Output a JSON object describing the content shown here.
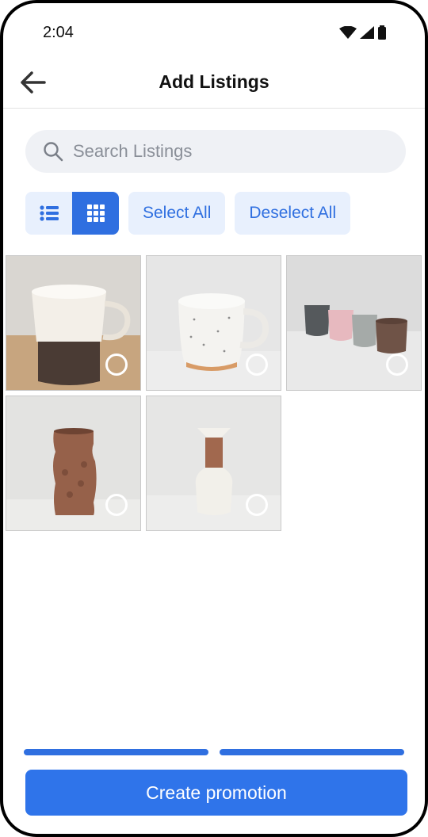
{
  "status_bar": {
    "time": "2:04",
    "icons": [
      "wifi-icon",
      "signal-icon",
      "battery-icon"
    ]
  },
  "header": {
    "title": "Add Listings",
    "back_icon": "arrow-left-icon"
  },
  "search": {
    "placeholder": "Search Listings",
    "value": "",
    "icon": "search-icon"
  },
  "view_toggle": {
    "options": [
      "list-view",
      "grid-view"
    ],
    "selected": "grid-view"
  },
  "actions": {
    "select_all": "Select All",
    "deselect_all": "Deselect All"
  },
  "listings": [
    {
      "subject": "two-tone mug, cream and brown",
      "selected": false
    },
    {
      "subject": "speckled white mug",
      "selected": false
    },
    {
      "subject": "four pastel cups",
      "selected": false
    },
    {
      "subject": "textured terracotta vase",
      "selected": false
    },
    {
      "subject": "white bottle vase",
      "selected": false
    }
  ],
  "progress_steps": 2,
  "footer": {
    "create_label": "Create promotion"
  },
  "colors": {
    "accent": "#2f6fe0",
    "accent_light": "#e8f0fd",
    "search_bg": "#eff1f5"
  }
}
